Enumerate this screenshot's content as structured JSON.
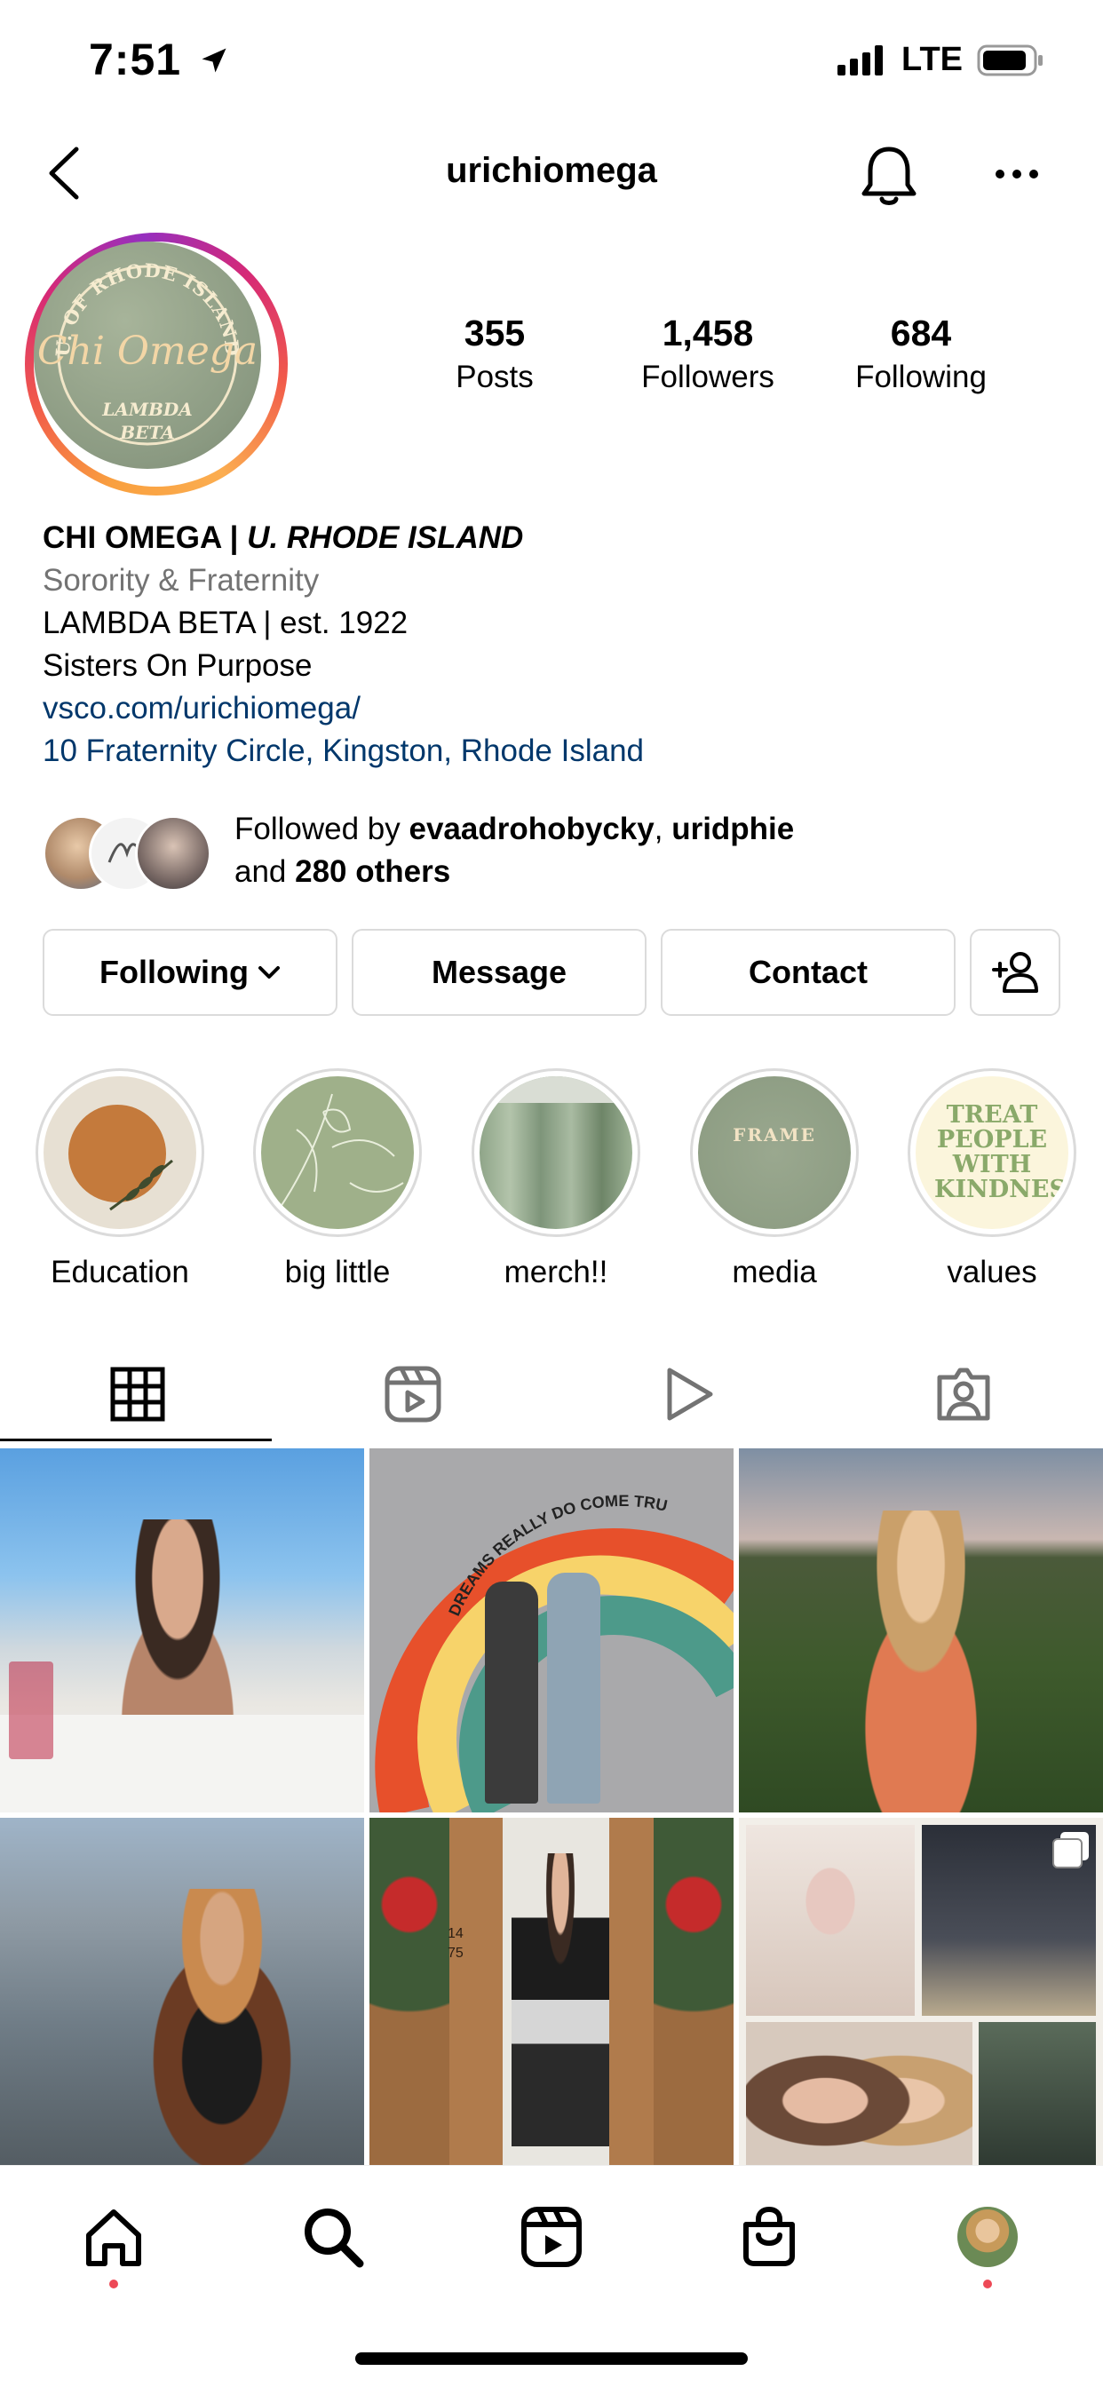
{
  "status": {
    "time": "7:51",
    "network": "LTE"
  },
  "header": {
    "username": "urichiomega"
  },
  "profile": {
    "avatar_text": {
      "top": "U. OF RHODE ISLAND",
      "script": "Chi Omega",
      "bottom1": "LAMBDA",
      "bottom2": "BETA"
    },
    "stats": [
      {
        "value": "355",
        "label": "Posts"
      },
      {
        "value": "1,458",
        "label": "Followers"
      },
      {
        "value": "684",
        "label": "Following"
      }
    ],
    "name_bold": "CHI OMEGA | ",
    "name_italic": "U. RHODE ISLAND",
    "category": "Sorority & Fraternity",
    "bio_lines": [
      "LAMBDA BETA | est. 1922",
      "Sisters On Purpose"
    ],
    "link": "vsco.com/urichiomega/",
    "address": "10 Fraternity Circle, Kingston, Rhode Island",
    "followed_by": {
      "prefix": "Followed by ",
      "user1": "evaadrohobycky",
      "sep": ", ",
      "user2": "uridphie",
      "line2_prefix": "and ",
      "others": "280 others"
    }
  },
  "buttons": {
    "following": "Following",
    "message": "Message",
    "contact": "Contact"
  },
  "highlights": [
    {
      "label": "Education"
    },
    {
      "label": "big little"
    },
    {
      "label": "merch!!"
    },
    {
      "label": "media",
      "overlay": "FRAME"
    },
    {
      "label": "values",
      "overlay": "TREAT PEOPLE WITH KINDNESS"
    }
  ],
  "grid_texts": {
    "rainbow_mural": "DREAMS REALLY DO COME TRUE",
    "door_number": "1475"
  },
  "colors": {
    "link": "#00376b",
    "accent_dot": "#ed4956",
    "sage": "#8b9a82",
    "border": "#dbdbdb"
  }
}
